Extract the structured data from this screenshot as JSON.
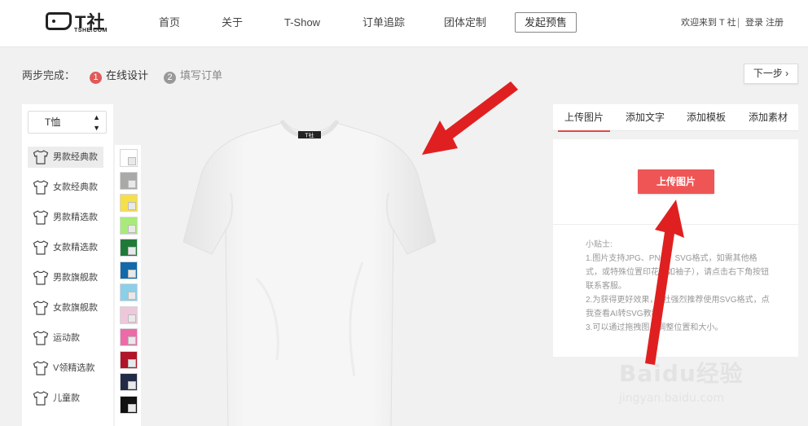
{
  "header": {
    "logo_text": "T社",
    "logo_sub": "TSHE.COM",
    "nav": [
      "首页",
      "关于",
      "T-Show",
      "订单追踪",
      "团体定制"
    ],
    "cta": "发起预售",
    "welcome": "欢迎来到 T 社",
    "login": "登录",
    "register": "注册"
  },
  "steps": {
    "label": "两步完成：",
    "items": [
      {
        "num": "1",
        "label": "在线设计"
      },
      {
        "num": "2",
        "label": "填写订单"
      }
    ],
    "next": "下一步 ›"
  },
  "product": {
    "type_select": "T恤",
    "styles": [
      "男款经典款",
      "女款经典款",
      "男款精选款",
      "女款精选款",
      "男款旗舰款",
      "女款旗舰款",
      "运动款",
      "V领精选款",
      "儿童款"
    ],
    "colors": [
      "#ffffff",
      "#a9a9a7",
      "#f5e04a",
      "#a8eb7a",
      "#1f7a3a",
      "#1469a8",
      "#8ccfe8",
      "#eec8da",
      "#ec6aa8",
      "#b0152a",
      "#222a46",
      "#111111"
    ],
    "tee_color": "#f4f4f4",
    "tee_label": "T社"
  },
  "right": {
    "tabs": [
      "上传图片",
      "添加文字",
      "添加模板",
      "添加素材"
    ],
    "upload_button": "上传图片",
    "tips_title": "小贴士:",
    "tips": [
      "1.图片支持JPG、PNG、SVG格式，如需其他格式，或特殊位置印花（如袖子），请点击右下角按钮联系客服。",
      "2.为获得更好效果，T社强烈推荐使用SVG格式，点我查看AI转SVG教程。",
      "3.可以通过拖拽图片调整位置和大小。"
    ]
  },
  "annotation": {
    "arrow_color": "#e02020"
  },
  "watermark": {
    "main": "Baidu经验",
    "sub": "jingyan.baidu.com"
  }
}
